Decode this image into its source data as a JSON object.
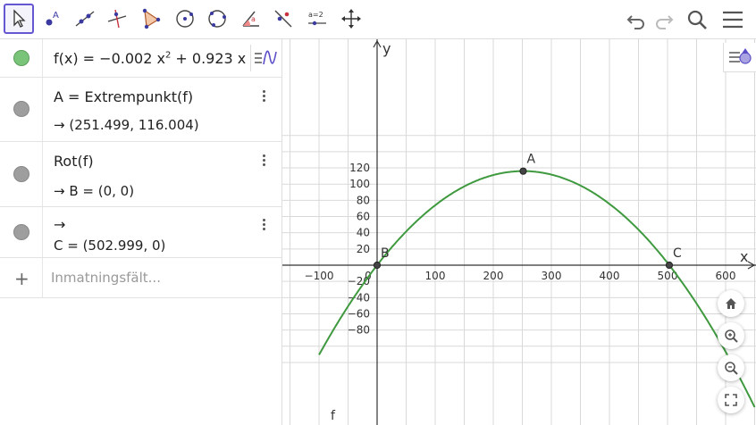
{
  "toolbar": {
    "tools": [
      "move-tool",
      "point-tool",
      "line-tool",
      "perpendicular-line-tool",
      "polygon-tool",
      "circle-tool",
      "conic-tool",
      "angle-tool",
      "reflect-tool",
      "slider-tool",
      "move-graphics-view-tool"
    ],
    "slider_label": "a=2",
    "icons": [
      "undo-icon",
      "redo-icon",
      "search-icon",
      "menu-icon"
    ]
  },
  "algebra": {
    "row1": {
      "func": "f(x) = −0.002 x",
      "exp": "2",
      "rest": " + 0.923 x"
    },
    "row2": {
      "def": "A = Extrempunkt(f)",
      "value": "→ (251.499, 116.004)"
    },
    "row3": {
      "def": "Rot(f)",
      "value": "→ B = (0, 0)"
    },
    "row4": {
      "def": "→",
      "value": "C = (502.999, 0)"
    },
    "input": {
      "plus": "+",
      "placeholder": "Inmatningsfält..."
    }
  },
  "graph": {
    "x_label": "x",
    "y_label": "y",
    "x_ticks": [
      "−100",
      "0",
      "100",
      "200",
      "300",
      "400",
      "500",
      "600"
    ],
    "y_ticks": [
      "120",
      "100",
      "80",
      "60",
      "40",
      "20",
      "−20",
      "−40",
      "−60",
      "−80"
    ],
    "points": [
      {
        "name": "A",
        "x": 251.499,
        "y": 116.004
      },
      {
        "name": "B",
        "x": 0,
        "y": 0
      },
      {
        "name": "C",
        "x": 502.999,
        "y": 0
      }
    ],
    "curve_label": "f",
    "curve": {
      "a": -0.001834,
      "b": 0.9226
    },
    "colors": {
      "curve": "#3f9a3f",
      "grid": "#d9d9d9",
      "axis": "#333333",
      "point": "#444444"
    }
  }
}
